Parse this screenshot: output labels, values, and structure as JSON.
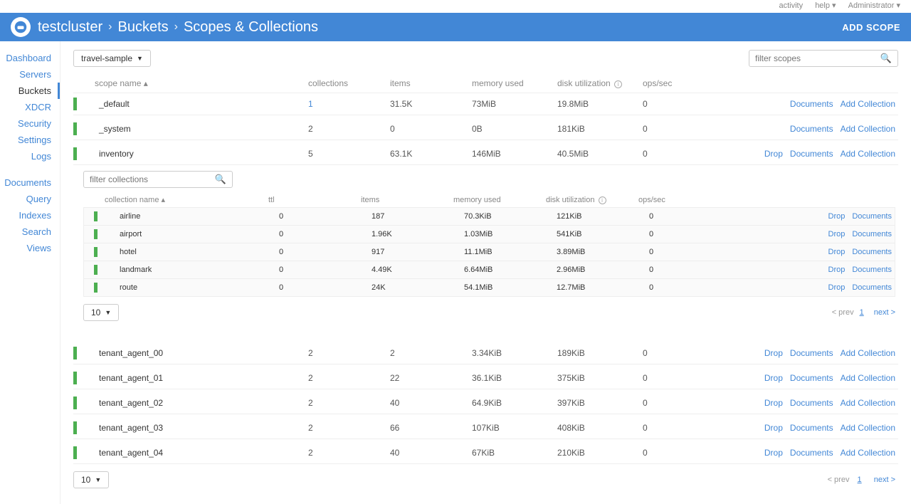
{
  "topbar": {
    "activity": "activity",
    "help": "help ▾",
    "admin": "Administrator ▾"
  },
  "header": {
    "cluster": "testcluster",
    "b1": "Buckets",
    "b2": "Scopes & Collections",
    "add_scope": "ADD SCOPE"
  },
  "sidebar": {
    "items1": [
      "Dashboard",
      "Servers",
      "Buckets",
      "XDCR",
      "Security",
      "Settings",
      "Logs"
    ],
    "items2": [
      "Documents",
      "Query",
      "Indexes",
      "Search",
      "Views"
    ],
    "active": "Buckets"
  },
  "bucket_dropdown": "travel-sample",
  "filter_scopes_ph": "filter scopes",
  "filter_collections_ph": "filter collections",
  "scope_headers": [
    "scope name ▴",
    "collections",
    "items",
    "memory used",
    "disk utilization",
    "ops/sec"
  ],
  "coll_headers": [
    "collection name ▴",
    "ttl",
    "items",
    "memory used",
    "disk utilization",
    "ops/sec"
  ],
  "scopes": [
    {
      "name": "_default",
      "coll_count": "1",
      "coll_link": true,
      "items": "31.5K",
      "mem": "73MiB",
      "disk": "19.8MiB",
      "ops": "0",
      "drop": false
    },
    {
      "name": "_system",
      "coll_count": "2",
      "coll_link": false,
      "items": "0",
      "mem": "0B",
      "disk": "181KiB",
      "ops": "0",
      "drop": false
    },
    {
      "name": "inventory",
      "coll_count": "5",
      "coll_link": false,
      "items": "63.1K",
      "mem": "146MiB",
      "disk": "40.5MiB",
      "ops": "0",
      "drop": true,
      "collections": [
        {
          "name": "airline",
          "ttl": "0",
          "items": "187",
          "mem": "70.3KiB",
          "disk": "121KiB",
          "ops": "0"
        },
        {
          "name": "airport",
          "ttl": "0",
          "items": "1.96K",
          "mem": "1.03MiB",
          "disk": "541KiB",
          "ops": "0"
        },
        {
          "name": "hotel",
          "ttl": "0",
          "items": "917",
          "mem": "11.1MiB",
          "disk": "3.89MiB",
          "ops": "0"
        },
        {
          "name": "landmark",
          "ttl": "0",
          "items": "4.49K",
          "mem": "6.64MiB",
          "disk": "2.96MiB",
          "ops": "0"
        },
        {
          "name": "route",
          "ttl": "0",
          "items": "24K",
          "mem": "54.1MiB",
          "disk": "12.7MiB",
          "ops": "0"
        }
      ]
    },
    {
      "name": "tenant_agent_00",
      "coll_count": "2",
      "coll_link": false,
      "items": "2",
      "mem": "3.34KiB",
      "disk": "189KiB",
      "ops": "0",
      "drop": true
    },
    {
      "name": "tenant_agent_01",
      "coll_count": "2",
      "coll_link": false,
      "items": "22",
      "mem": "36.1KiB",
      "disk": "375KiB",
      "ops": "0",
      "drop": true
    },
    {
      "name": "tenant_agent_02",
      "coll_count": "2",
      "coll_link": false,
      "items": "40",
      "mem": "64.9KiB",
      "disk": "397KiB",
      "ops": "0",
      "drop": true
    },
    {
      "name": "tenant_agent_03",
      "coll_count": "2",
      "coll_link": false,
      "items": "66",
      "mem": "107KiB",
      "disk": "408KiB",
      "ops": "0",
      "drop": true
    },
    {
      "name": "tenant_agent_04",
      "coll_count": "2",
      "coll_link": false,
      "items": "40",
      "mem": "67KiB",
      "disk": "210KiB",
      "ops": "0",
      "drop": true
    }
  ],
  "page_size": "10",
  "labels": {
    "drop": "Drop",
    "documents": "Documents",
    "add_collection": "Add Collection",
    "prev": "< prev",
    "next": "next >",
    "page1": "1"
  }
}
